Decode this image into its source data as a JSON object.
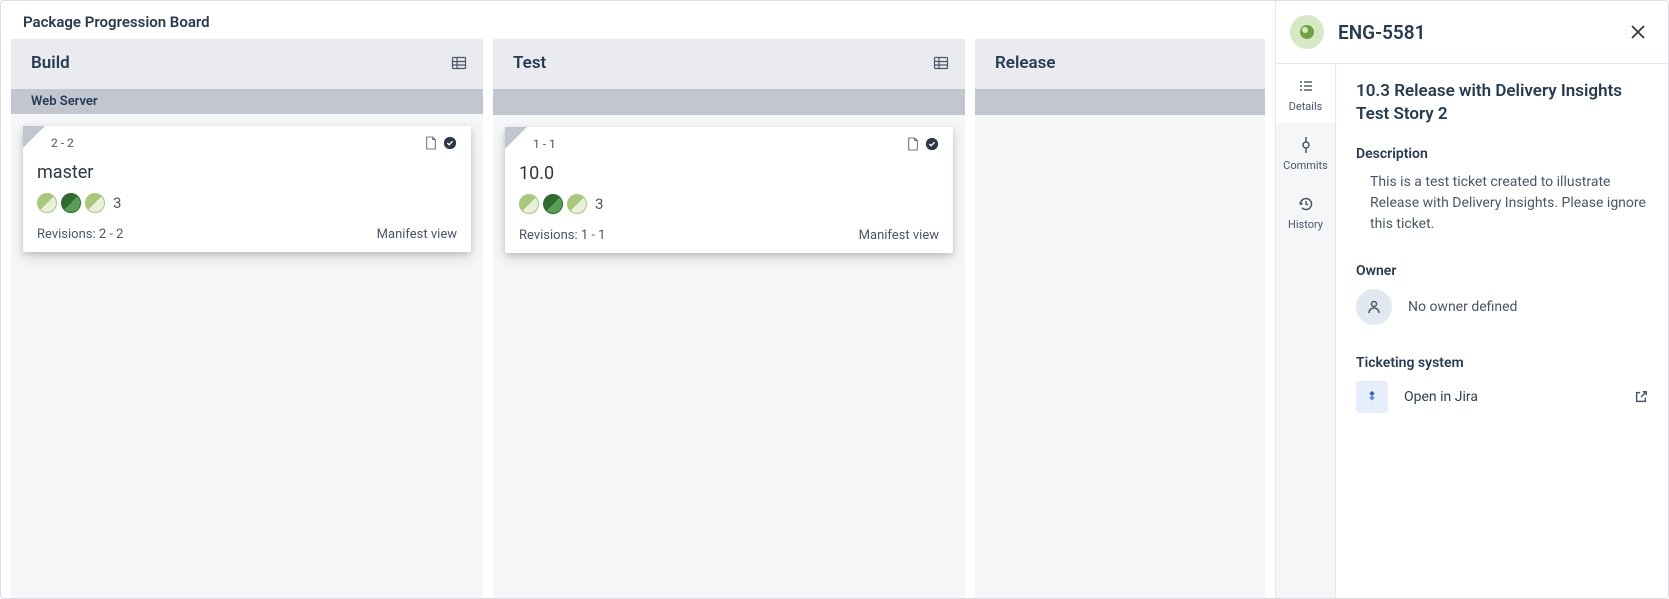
{
  "board": {
    "title": "Package Progression Board",
    "swimlane": "Web Server",
    "columns": [
      {
        "title": "Build",
        "card": {
          "range": "2 - 2",
          "name": "master",
          "count": "3",
          "revisions": "Revisions: 2 - 2",
          "manifest": "Manifest view"
        }
      },
      {
        "title": "Test",
        "card": {
          "range": "1 - 1",
          "name": "10.0",
          "count": "3",
          "revisions": "Revisions: 1 - 1",
          "manifest": "Manifest view"
        }
      },
      {
        "title": "Release"
      }
    ]
  },
  "panel": {
    "issue_key": "ENG-5581",
    "tabs": {
      "details": "Details",
      "commits": "Commits",
      "history": "History"
    },
    "title": "10.3 Release with Delivery Insights Test Story 2",
    "description_label": "Description",
    "description_text": "This is a test ticket created to illustrate Release with Delivery Insights. Please ignore this ticket.",
    "owner_label": "Owner",
    "owner_text": "No owner defined",
    "ticketing_label": "Ticketing system",
    "ticketing_link": "Open in Jira"
  }
}
